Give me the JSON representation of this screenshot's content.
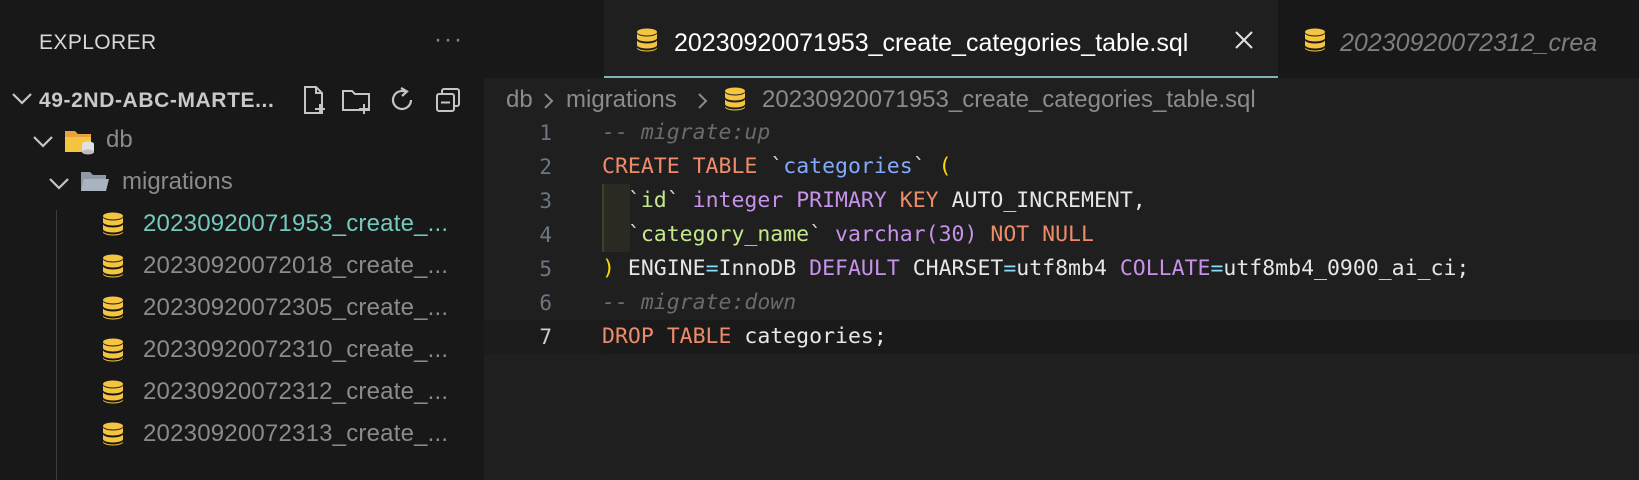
{
  "sidebar": {
    "title": "EXPLORER",
    "more": "···",
    "root_label": "49-2ND-ABC-MARTE...",
    "folders": [
      {
        "label": "db"
      },
      {
        "label": "migrations"
      }
    ],
    "files": [
      {
        "label": "20230920071953_create_...",
        "active": true
      },
      {
        "label": "20230920072018_create_...",
        "active": false
      },
      {
        "label": "20230920072305_create_...",
        "active": false
      },
      {
        "label": "20230920072310_create_...",
        "active": false
      },
      {
        "label": "20230920072312_create_...",
        "active": false
      },
      {
        "label": "20230920072313_create_...",
        "active": false
      }
    ]
  },
  "tabs": [
    {
      "label": "20230920071953_create_categories_table.sql",
      "active": true
    },
    {
      "label": "20230920072312_crea",
      "active": false
    }
  ],
  "breadcrumb": {
    "items": [
      "db",
      "migrations",
      "20230920071953_create_categories_table.sql"
    ]
  },
  "code": {
    "line_numbers": [
      "1",
      "2",
      "3",
      "4",
      "5",
      "6",
      "7"
    ],
    "current_line": 7
  },
  "colors": {
    "background": "#1f1f1f",
    "sidebar": "#181818",
    "active_file": "#73c9bd",
    "db_icon": "#f5c542",
    "keyword": "#ee8c6a",
    "type_keyword": "#c792ea",
    "identifier": "#82aaff"
  }
}
